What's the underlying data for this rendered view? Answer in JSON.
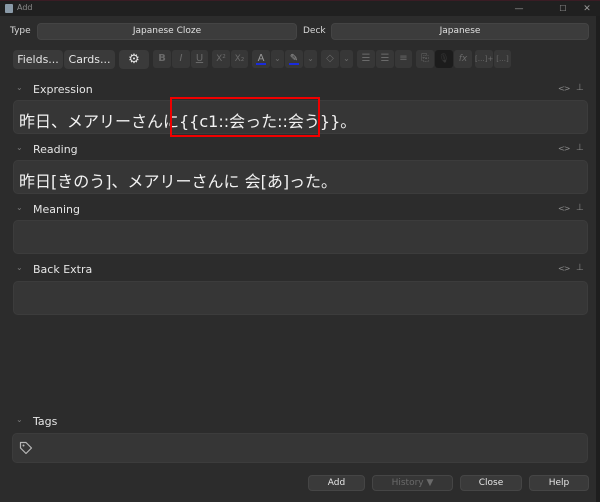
{
  "window": {
    "title": "Add",
    "controls": {
      "minimize": "—",
      "maximize": "☐",
      "close": "✕"
    }
  },
  "header": {
    "type_label": "Type",
    "type_value": "Japanese Cloze",
    "deck_label": "Deck",
    "deck_value": "Japanese"
  },
  "toolbar": {
    "fields_label": "Fields...",
    "cards_label": "Cards...",
    "gear_icon": "⚙",
    "format_buttons": [
      {
        "name": "bold-button",
        "glyph": "B"
      },
      {
        "name": "italic-button",
        "glyph": "I"
      },
      {
        "name": "underline-button",
        "glyph": "U"
      },
      {
        "name": "superscript-button",
        "glyph": "X²"
      },
      {
        "name": "subscript-button",
        "glyph": "X₂"
      },
      {
        "name": "text-color-button",
        "glyph": "A"
      },
      {
        "name": "text-color-dropdown",
        "glyph": "⌄"
      },
      {
        "name": "highlight-color-button",
        "glyph": "✎"
      },
      {
        "name": "highlight-color-dropdown",
        "glyph": "⌄"
      },
      {
        "name": "eraser-button",
        "glyph": "◇"
      },
      {
        "name": "eraser-dropdown",
        "glyph": "⌄"
      },
      {
        "name": "unordered-list-button",
        "glyph": "☰"
      },
      {
        "name": "ordered-list-button",
        "glyph": "☰"
      },
      {
        "name": "align-button",
        "glyph": "≡"
      },
      {
        "name": "attach-button",
        "glyph": "⎘"
      },
      {
        "name": "record-audio-button",
        "glyph": "🎙"
      },
      {
        "name": "mathjax-button",
        "glyph": "fx"
      },
      {
        "name": "cloze-new-button",
        "glyph": "[…]+"
      },
      {
        "name": "cloze-same-button",
        "glyph": "[…]"
      }
    ],
    "color_bar": "#1a2bdc"
  },
  "fields": [
    {
      "name": "Expression",
      "value": "昨日、メアリーさんに{{c1::会った::会う}}。"
    },
    {
      "name": "Reading",
      "value": "昨日[きのう]、メアリーさんに 会[あ]った。"
    },
    {
      "name": "Meaning",
      "value": ""
    },
    {
      "name": "Back Extra",
      "value": ""
    }
  ],
  "field_icons": {
    "html_toggle": "<>",
    "pin": "⊥"
  },
  "tags": {
    "label": "Tags",
    "value": ""
  },
  "buttons": {
    "add": "Add",
    "history": "History ▼",
    "close": "Close",
    "help": "Help"
  },
  "highlight_color": "#f00000"
}
